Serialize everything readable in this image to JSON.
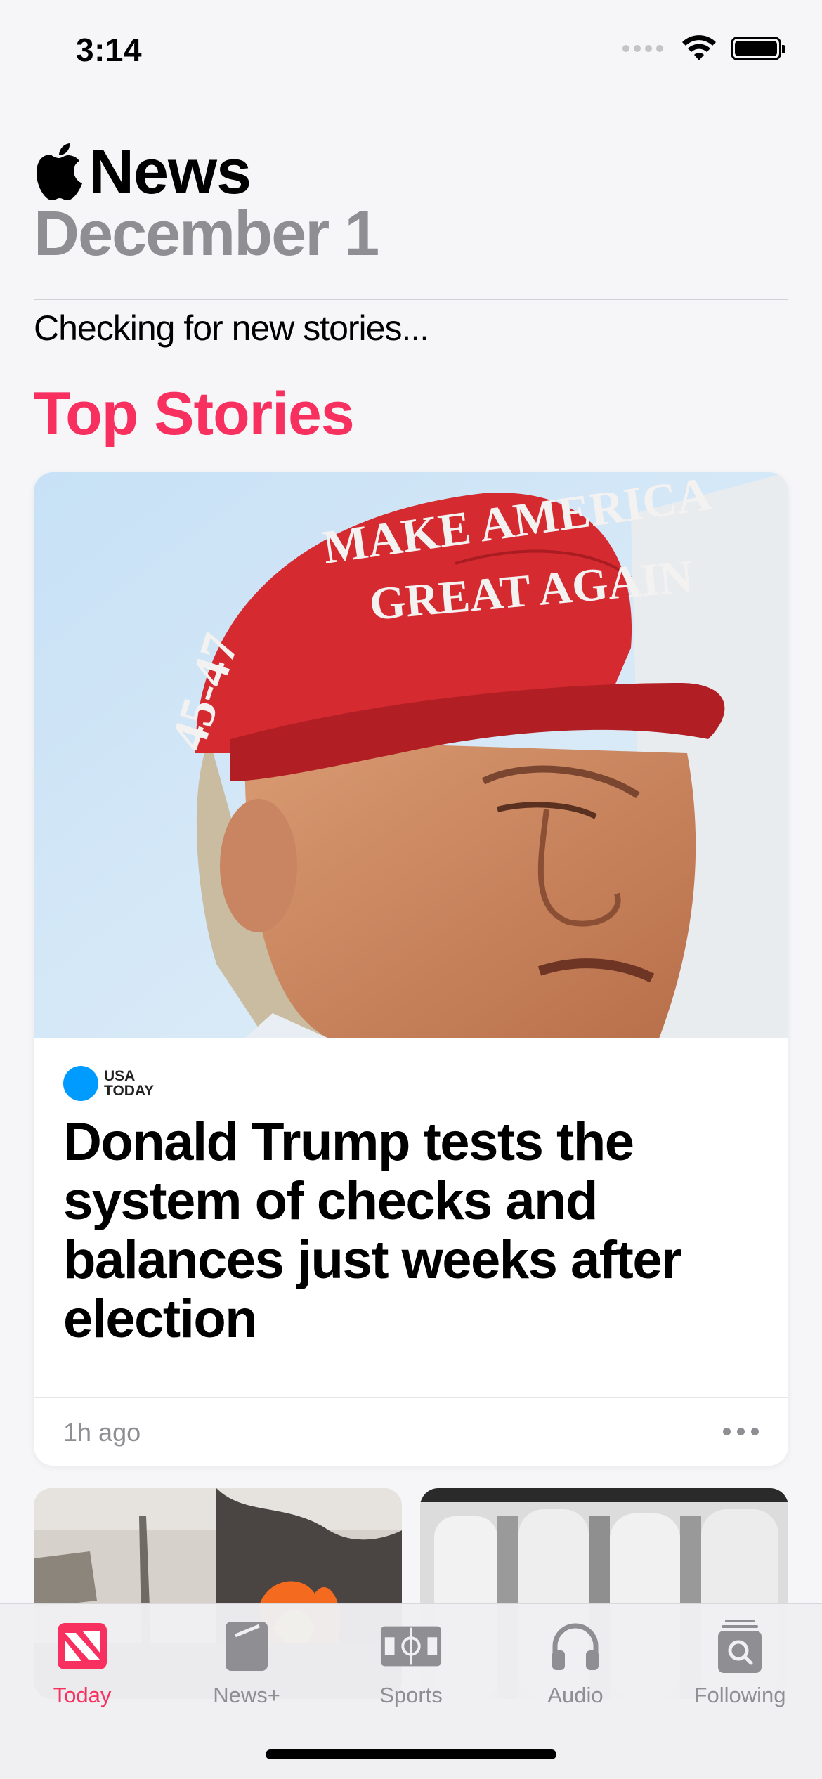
{
  "status_bar": {
    "time": "3:14"
  },
  "header": {
    "app_title": "News",
    "date": "December 1",
    "status_message": "Checking for new stories..."
  },
  "section": {
    "title": "Top Stories"
  },
  "top_story": {
    "source_line1": "USA",
    "source_line2": "TODAY",
    "headline": "Donald Trump tests the system of checks and balances just weeks after election",
    "time_ago": "1h ago",
    "image_caption_text": [
      "MAKE AMERICA",
      "GREAT AGAIN",
      "45-47"
    ]
  },
  "tabs": [
    {
      "label": "Today",
      "icon": "news-today-icon",
      "active": true
    },
    {
      "label": "News+",
      "icon": "news-plus-icon",
      "active": false
    },
    {
      "label": "Sports",
      "icon": "sports-field-icon",
      "active": false
    },
    {
      "label": "Audio",
      "icon": "headphones-icon",
      "active": false
    },
    {
      "label": "Following",
      "icon": "following-search-icon",
      "active": false
    }
  ],
  "colors": {
    "accent": "#f7305f",
    "secondary_text": "#8e8e93",
    "source_brand": "#009bff"
  }
}
